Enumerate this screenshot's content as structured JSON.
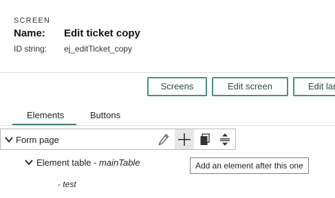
{
  "header": {
    "kicker": "SCREEN",
    "name_label": "Name:",
    "name_value": "Edit ticket copy",
    "id_label": "ID string:",
    "id_value": "ej_editTicket_copy"
  },
  "actions": {
    "screens": "Screens",
    "edit_screen": "Edit screen",
    "edit_language": "Edit lan"
  },
  "tabs": {
    "elements": "Elements",
    "buttons": "Buttons",
    "active": "Elements"
  },
  "tree": {
    "row": {
      "label": "Form page"
    },
    "child": {
      "prefix": "Element table - ",
      "id": "mainTable"
    },
    "leaf": {
      "prefix": "- ",
      "id": "test"
    }
  },
  "toolbar_icons": [
    "pencil-icon",
    "plus-icon",
    "copy-icon",
    "move-icon"
  ],
  "tooltip": "Add an element after this one",
  "colors": {
    "accent": "#4e8c83",
    "button_text": "#2c4b47",
    "hover_bg": "#e6e6e6"
  }
}
